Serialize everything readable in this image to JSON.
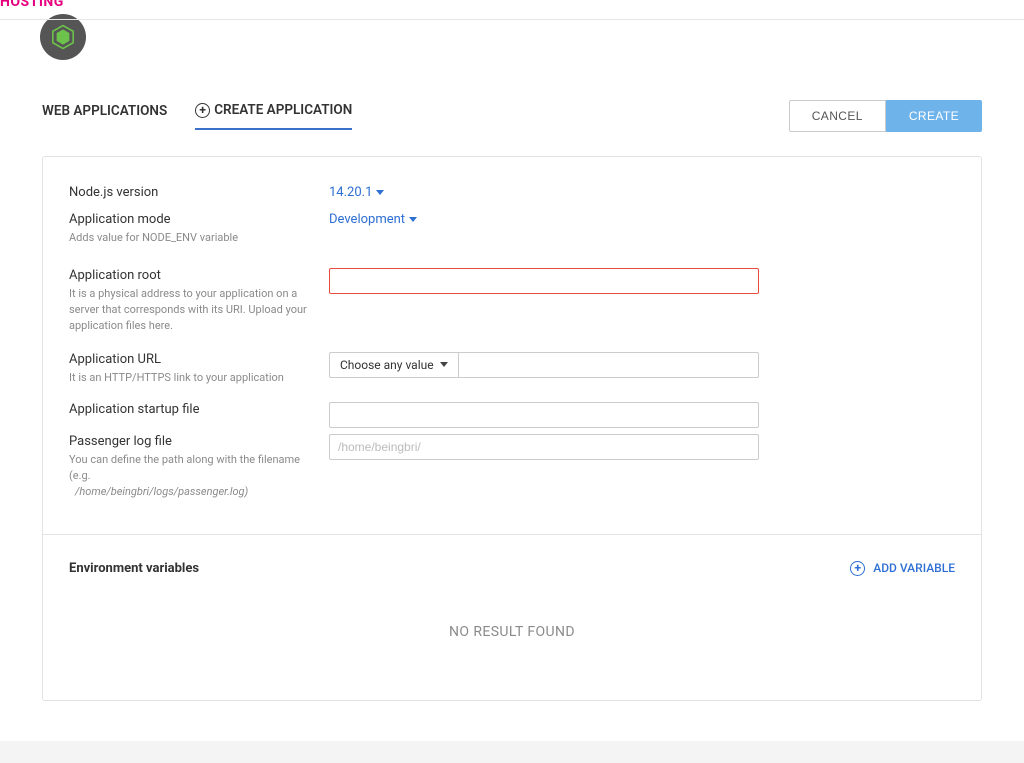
{
  "brand": "HOSTING",
  "tabs": {
    "web_applications": "WEB APPLICATIONS",
    "create_application": "CREATE APPLICATION"
  },
  "actions": {
    "cancel": "CANCEL",
    "create": "CREATE"
  },
  "form": {
    "node_version_label": "Node.js version",
    "node_version_value": "14.20.1",
    "app_mode_label": "Application mode",
    "app_mode_value": "Development",
    "app_mode_help": "Adds value for NODE_ENV variable",
    "app_root_label": "Application root",
    "app_root_help": "It is a physical address to your application on a server that corresponds with its URI. Upload your application files here.",
    "app_url_label": "Application URL",
    "app_url_help": "It is an HTTP/HTTPS link to your application",
    "app_url_choose": "Choose any value",
    "startup_label": "Application startup file",
    "log_label": "Passenger log file",
    "log_placeholder": "/home/beingbri/",
    "log_help": "You can define the path along with the filename (e.g.",
    "log_help_example": "/home/beingbri/logs/passenger.log)"
  },
  "env": {
    "title": "Environment variables",
    "add_label": "ADD VARIABLE",
    "empty": "NO RESULT FOUND"
  }
}
